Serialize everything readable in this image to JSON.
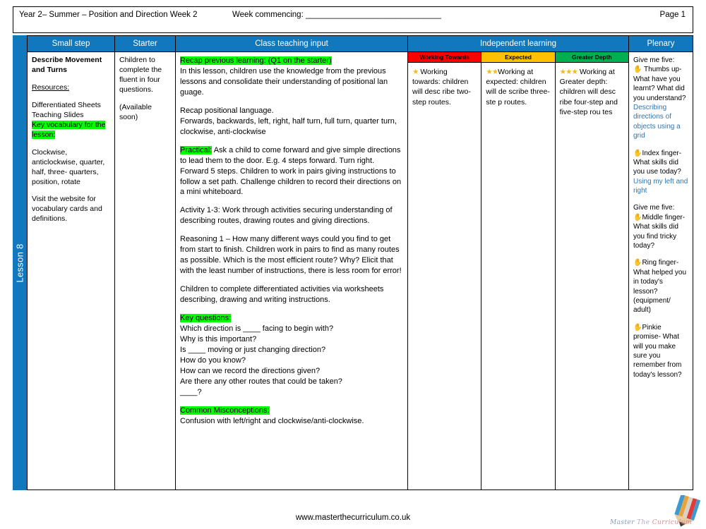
{
  "header": {
    "title": "Year 2– Summer – Position and Direction Week 2",
    "week_commencing": "Week commencing: ______________________________",
    "page": "Page 1"
  },
  "lesson_band": {
    "label": "Lesson 8"
  },
  "columns": {
    "small_step": "Small step",
    "starter": "Starter",
    "class_teaching_input": "Class teaching input",
    "independent_learning": "Independent learning",
    "plenary": "Plenary"
  },
  "colors": {
    "brand_blue": "#1278be",
    "highlight_green": "#00ff00",
    "working_towards": "#ff0000",
    "expected": "#ffc000",
    "greater_depth": "#00b050",
    "answer_blue": "#2e75b6",
    "star_gold": "#f5b820",
    "hand_brown": "#a0673a"
  },
  "small_step": {
    "title": "Describe Movement and Turns",
    "resources_heading": "Resources:",
    "resources_lines": [
      "Differentiated Sheets",
      "Teaching Slides"
    ],
    "key_vocab_heading": "Key vocabulary for the lesson:",
    "vocabulary": "Clockwise, anticlockwise, quarter, half, three- quarters, position, rotate",
    "website_note": "Visit the website for vocabulary cards and definitions."
  },
  "starter": {
    "line1": "Children to complete the fluent in four questions.",
    "line2": "(Available soon)"
  },
  "teaching": {
    "recap_heading": "Recap previous learning: (Q1 on the starter)",
    "recap_body": "In this lesson, children use the knowledge from the previous lessons and consolidate their understanding of positional lan guage.",
    "recap_positional_heading": "Recap positional language.",
    "recap_positional_body": "Forwards, backwards, left, right, half turn, full turn, quarter turn, clockwise, anti-clockwise",
    "practical_heading": "Practical:",
    "practical_body": " Ask a child to come forward and give simple directions to lead them to the door. E.g. 4 steps forward. Turn right. Forward 5 steps. Children to work in pairs giving instructions to follow a set path.  Challenge children to record their directions on a mini whiteboard.",
    "activity": "Activity 1-3: Work through activities securing understanding of describing routes, drawing routes and giving directions.",
    "reasoning": "Reasoning 1 – How many different ways could you find to get from start to finish.  Children work in pairs to find as many routes as possible.  Which is the most efficient route?  Why?   Elicit that with the least number of instructions, there is less room for error!",
    "differentiated": "Children to complete differentiated activities via worksheets describing, drawing and writing instructions.",
    "key_questions_heading": "Key questions:",
    "key_questions": [
      "Which direction is ____ facing to begin with?",
      "Why is this important?",
      "Is ____ moving or just changing direction?",
      "How do you know?",
      "How can we record the directions given?",
      "Are there any other routes that could be taken?",
      "____?"
    ],
    "misconceptions_heading": "Common Misconceptions:",
    "misconceptions_body": "Confusion with left/right and clockwise/anti-clockwise."
  },
  "independent": {
    "bands": [
      {
        "label": "Working Towards",
        "stars": "★",
        "star_count": 1,
        "text": " Working towards: children will desc ribe two-step routes."
      },
      {
        "label": "Expected",
        "stars": "★★",
        "star_count": 2,
        "text": "Working at expected: children will de scribe three-ste p   routes."
      },
      {
        "label": "Greater Depth",
        "stars": "★★★",
        "star_count": 3,
        "text": " Working at Greater depth: children will desc ribe four-step and five-step rou tes"
      }
    ]
  },
  "plenary": {
    "groups": [
      {
        "intro": "Give me five:",
        "hand": "✋",
        "prompt": " Thumbs up- What have you learnt? What did you understand?",
        "answer": "Describing directions of objects using a grid"
      },
      {
        "intro": "",
        "hand": "✋",
        "prompt": "Index finger- What skills did you use today?",
        "answer": "Using my left and right"
      },
      {
        "intro": "Give me five:",
        "hand": "✋",
        "prompt": "Middle finger- What skills did you find tricky today?",
        "answer": ""
      },
      {
        "intro": "",
        "hand": "✋",
        "prompt": "Ring finger- What helped you in today's lesson? (equipment/ adult)",
        "answer": ""
      },
      {
        "intro": "",
        "hand": "✋",
        "prompt": "Pinkie promise- What will you make sure you remember from today's lesson?",
        "answer": ""
      }
    ]
  },
  "footer": {
    "url": "www.masterthecurriculum.co.uk",
    "logo_word1": "Master",
    "logo_word2": "The",
    "logo_word3": "Curriculum"
  }
}
